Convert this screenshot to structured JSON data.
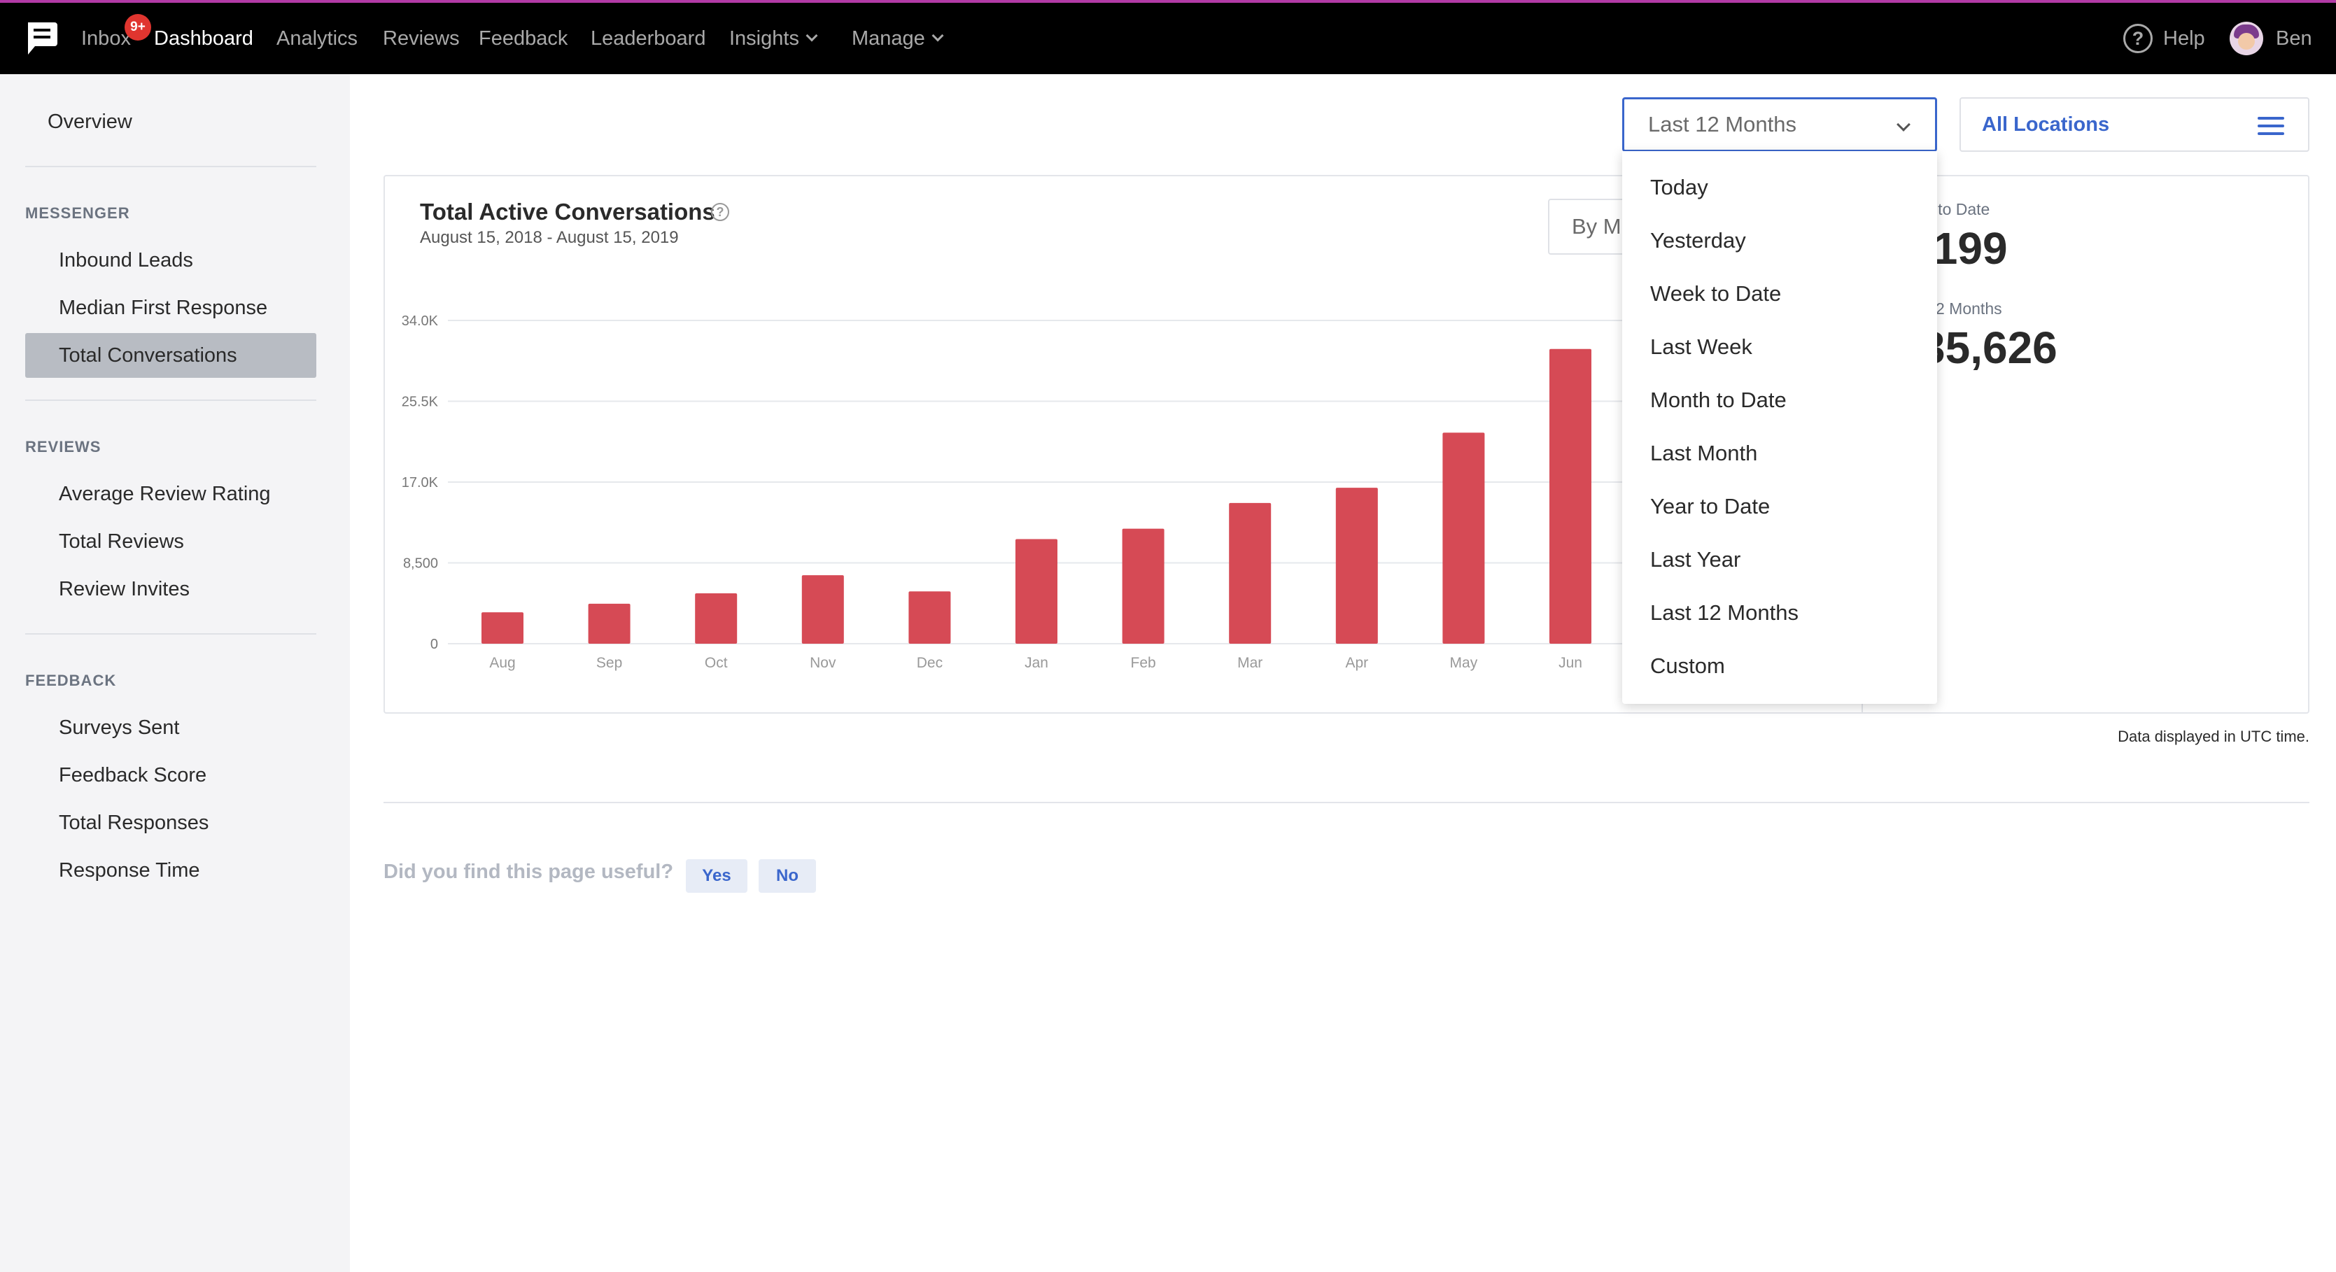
{
  "nav": {
    "items": [
      "Inbox",
      "Dashboard",
      "Analytics",
      "Reviews",
      "Feedback",
      "Leaderboard",
      "Insights",
      "Manage"
    ],
    "inbox_badge": "9+",
    "help": "Help",
    "user": "Ben",
    "accent": "#b23aa6"
  },
  "sidebar": {
    "overview": "Overview",
    "sections": [
      {
        "title": "MESSENGER",
        "items": [
          "Inbound Leads",
          "Median First Response",
          "Total Conversations"
        ]
      },
      {
        "title": "REVIEWS",
        "items": [
          "Average Review Rating",
          "Total Reviews",
          "Review Invites"
        ]
      },
      {
        "title": "FEEDBACK",
        "items": [
          "Surveys Sent",
          "Feedback Score",
          "Total Responses",
          "Response Time"
        ]
      }
    ],
    "active_item": "Total Conversations"
  },
  "filters": {
    "date_range": "Last 12 Months",
    "locations": "All Locations",
    "date_options": [
      "Today",
      "Yesterday",
      "Week to Date",
      "Last Week",
      "Month to Date",
      "Last Month",
      "Year to Date",
      "Last Year",
      "Last 12 Months",
      "Custom"
    ]
  },
  "card": {
    "title": "Total Active Conversations",
    "subtitle": "August 15, 2018 - August 15, 2019",
    "group_by": "By M",
    "stats": [
      {
        "label": "h to Date",
        "value": ",199"
      },
      {
        "label": "2 Months",
        "value": "35,626"
      }
    ]
  },
  "chart_data": {
    "type": "bar",
    "title": "Total Active Conversations",
    "subtitle": "August 15, 2018 - August 15, 2019",
    "categories": [
      "Aug",
      "Sep",
      "Oct",
      "Nov",
      "Dec",
      "Jan",
      "Feb",
      "Mar",
      "Apr",
      "May",
      "Jun"
    ],
    "values": [
      3300,
      4200,
      5300,
      7200,
      5500,
      11000,
      12100,
      14800,
      16400,
      22200,
      31000
    ],
    "y_ticks": [
      0,
      8500,
      17000,
      25500,
      34000
    ],
    "y_tick_labels": [
      "0",
      "8,500",
      "17.0K",
      "25.5K",
      "34.0K"
    ],
    "ylim": [
      0,
      34000
    ],
    "bar_color": "#d64a55",
    "grid": true
  },
  "footer": {
    "utc_note": "Data displayed in UTC time.",
    "useful_question": "Did you find this page useful?",
    "yes": "Yes",
    "no": "No"
  }
}
